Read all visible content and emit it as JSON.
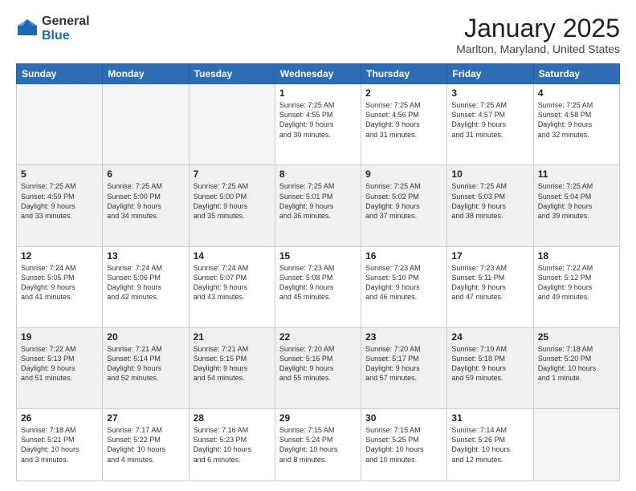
{
  "logo": {
    "general": "General",
    "blue": "Blue"
  },
  "header": {
    "month": "January 2025",
    "location": "Marlton, Maryland, United States"
  },
  "weekdays": [
    "Sunday",
    "Monday",
    "Tuesday",
    "Wednesday",
    "Thursday",
    "Friday",
    "Saturday"
  ],
  "weeks": [
    [
      {
        "day": "",
        "info": "",
        "empty": true
      },
      {
        "day": "",
        "info": "",
        "empty": true
      },
      {
        "day": "",
        "info": "",
        "empty": true
      },
      {
        "day": "1",
        "info": "Sunrise: 7:25 AM\nSunset: 4:55 PM\nDaylight: 9 hours\nand 30 minutes."
      },
      {
        "day": "2",
        "info": "Sunrise: 7:25 AM\nSunset: 4:56 PM\nDaylight: 9 hours\nand 31 minutes."
      },
      {
        "day": "3",
        "info": "Sunrise: 7:25 AM\nSunset: 4:57 PM\nDaylight: 9 hours\nand 31 minutes."
      },
      {
        "day": "4",
        "info": "Sunrise: 7:25 AM\nSunset: 4:58 PM\nDaylight: 9 hours\nand 32 minutes."
      }
    ],
    [
      {
        "day": "5",
        "info": "Sunrise: 7:25 AM\nSunset: 4:59 PM\nDaylight: 9 hours\nand 33 minutes."
      },
      {
        "day": "6",
        "info": "Sunrise: 7:25 AM\nSunset: 5:00 PM\nDaylight: 9 hours\nand 34 minutes."
      },
      {
        "day": "7",
        "info": "Sunrise: 7:25 AM\nSunset: 5:00 PM\nDaylight: 9 hours\nand 35 minutes."
      },
      {
        "day": "8",
        "info": "Sunrise: 7:25 AM\nSunset: 5:01 PM\nDaylight: 9 hours\nand 36 minutes."
      },
      {
        "day": "9",
        "info": "Sunrise: 7:25 AM\nSunset: 5:02 PM\nDaylight: 9 hours\nand 37 minutes."
      },
      {
        "day": "10",
        "info": "Sunrise: 7:25 AM\nSunset: 5:03 PM\nDaylight: 9 hours\nand 38 minutes."
      },
      {
        "day": "11",
        "info": "Sunrise: 7:25 AM\nSunset: 5:04 PM\nDaylight: 9 hours\nand 39 minutes."
      }
    ],
    [
      {
        "day": "12",
        "info": "Sunrise: 7:24 AM\nSunset: 5:05 PM\nDaylight: 9 hours\nand 41 minutes."
      },
      {
        "day": "13",
        "info": "Sunrise: 7:24 AM\nSunset: 5:06 PM\nDaylight: 9 hours\nand 42 minutes."
      },
      {
        "day": "14",
        "info": "Sunrise: 7:24 AM\nSunset: 5:07 PM\nDaylight: 9 hours\nand 43 minutes."
      },
      {
        "day": "15",
        "info": "Sunrise: 7:23 AM\nSunset: 5:08 PM\nDaylight: 9 hours\nand 45 minutes."
      },
      {
        "day": "16",
        "info": "Sunrise: 7:23 AM\nSunset: 5:10 PM\nDaylight: 9 hours\nand 46 minutes."
      },
      {
        "day": "17",
        "info": "Sunrise: 7:23 AM\nSunset: 5:11 PM\nDaylight: 9 hours\nand 47 minutes."
      },
      {
        "day": "18",
        "info": "Sunrise: 7:22 AM\nSunset: 5:12 PM\nDaylight: 9 hours\nand 49 minutes."
      }
    ],
    [
      {
        "day": "19",
        "info": "Sunrise: 7:22 AM\nSunset: 5:13 PM\nDaylight: 9 hours\nand 51 minutes."
      },
      {
        "day": "20",
        "info": "Sunrise: 7:21 AM\nSunset: 5:14 PM\nDaylight: 9 hours\nand 52 minutes."
      },
      {
        "day": "21",
        "info": "Sunrise: 7:21 AM\nSunset: 5:15 PM\nDaylight: 9 hours\nand 54 minutes."
      },
      {
        "day": "22",
        "info": "Sunrise: 7:20 AM\nSunset: 5:16 PM\nDaylight: 9 hours\nand 55 minutes."
      },
      {
        "day": "23",
        "info": "Sunrise: 7:20 AM\nSunset: 5:17 PM\nDaylight: 9 hours\nand 57 minutes."
      },
      {
        "day": "24",
        "info": "Sunrise: 7:19 AM\nSunset: 5:18 PM\nDaylight: 9 hours\nand 59 minutes."
      },
      {
        "day": "25",
        "info": "Sunrise: 7:18 AM\nSunset: 5:20 PM\nDaylight: 10 hours\nand 1 minute."
      }
    ],
    [
      {
        "day": "26",
        "info": "Sunrise: 7:18 AM\nSunset: 5:21 PM\nDaylight: 10 hours\nand 3 minutes."
      },
      {
        "day": "27",
        "info": "Sunrise: 7:17 AM\nSunset: 5:22 PM\nDaylight: 10 hours\nand 4 minutes."
      },
      {
        "day": "28",
        "info": "Sunrise: 7:16 AM\nSunset: 5:23 PM\nDaylight: 10 hours\nand 6 minutes."
      },
      {
        "day": "29",
        "info": "Sunrise: 7:15 AM\nSunset: 5:24 PM\nDaylight: 10 hours\nand 8 minutes."
      },
      {
        "day": "30",
        "info": "Sunrise: 7:15 AM\nSunset: 5:25 PM\nDaylight: 10 hours\nand 10 minutes."
      },
      {
        "day": "31",
        "info": "Sunrise: 7:14 AM\nSunset: 5:26 PM\nDaylight: 10 hours\nand 12 minutes."
      },
      {
        "day": "",
        "info": "",
        "empty": true
      }
    ]
  ]
}
